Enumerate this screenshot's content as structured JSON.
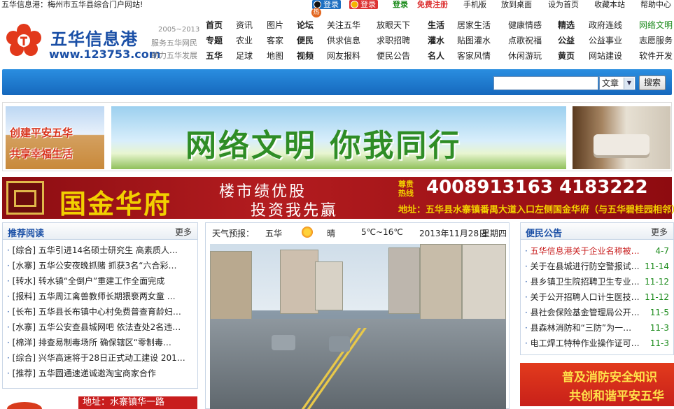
{
  "topbar": {
    "site_text": "五华信息港：梅州市五华县综合门户网站!",
    "qq_login": "登录",
    "weibo_login": "登录",
    "hot_badge": "热",
    "login": "登录",
    "register": "免费注册",
    "links": [
      "手机版",
      "放到桌面",
      "设为首页",
      "收藏本站",
      "帮助中心"
    ]
  },
  "logo": {
    "name": "五华信息港",
    "url": "www.123753.com",
    "years": "2005~2013",
    "tagline1": "服务五华网民",
    "tagline2": "助力五华发展"
  },
  "nav": {
    "rows": [
      [
        "首页",
        "资讯",
        "图片",
        "论坛",
        "关注五华",
        "放眼天下",
        "生活",
        "居家生活",
        "健康情感",
        "精选",
        "政府连线",
        "网络文明"
      ],
      [
        "专题",
        "农业",
        "客家",
        "便民",
        "供求信息",
        "求职招聘",
        "灌水",
        "贴图灌水",
        "点歌祝福",
        "公益",
        "公益事业",
        "志愿服务"
      ],
      [
        "五华",
        "足球",
        "地图",
        "视频",
        "网友报料",
        "便民公告",
        "名人",
        "客家风情",
        "休闲游玩",
        "黄页",
        "网站建设",
        "软件开发"
      ]
    ]
  },
  "search": {
    "value": "",
    "type_selected": "文章",
    "button": "搜索"
  },
  "banners": {
    "left_line1": "创建平安五华",
    "left_line2": "共享幸福生活",
    "center": "网络文明  你我同行"
  },
  "ad": {
    "brand": "国金华府",
    "slogan1": "楼市绩优股",
    "slogan2": "投资我先赢",
    "hotline_label": "尊贵热线",
    "tel": "4008913163  4183222",
    "address": "地址：五华县水寨镇番禺大道入口左侧国金华府（与五华碧桂园相邻）"
  },
  "recommend": {
    "title": "推荐阅读",
    "more": "更多",
    "items": [
      "[综合] 五华引进14名硕士研究生 高素质人…",
      "[水寨] 五华公安夜晚抓赌 抓获3名“六合彩…",
      "[转水] 转水镇“全倒户”重建工作全面完成",
      "[报料] 五华周江禽兽教师长期猥亵两女童 …",
      "[长布] 五华县长布镇中心村免费普查育龄妇…",
      "[水寨] 五华公安查县城网吧 依法查处2名违…",
      "[棉洋] 排查易制毒场所 确保辖区“零制毒…",
      "[综合] 兴华高速将于28日正式动工建设 201…",
      "[推荐] 五华圆通速递诚邀淘宝商家合作"
    ]
  },
  "weather": {
    "label": "天气预报：",
    "city": "五华",
    "condition": "晴",
    "temp": "5℃~16℃",
    "date": "2013年11月28日",
    "weekday": "星期四"
  },
  "notices": {
    "title": "便民公告",
    "more": "更多",
    "items": [
      {
        "text": "五华信息港关于企业名称被…",
        "date": "4-7",
        "highlight": true
      },
      {
        "text": "关于在县城进行防空警报试…",
        "date": "11-14",
        "highlight": false
      },
      {
        "text": "县乡镇卫生院招聘卫生专业…",
        "date": "11-12",
        "highlight": false
      },
      {
        "text": "关于公开招聘人口计生医技…",
        "date": "11-12",
        "highlight": false
      },
      {
        "text": "县社会保险基金管理局公开…",
        "date": "11-5",
        "highlight": false
      },
      {
        "text": "县森林消防和“三防”为一…",
        "date": "11-3",
        "highlight": false
      },
      {
        "text": "电工焊工特种作业操作证可…",
        "date": "11-3",
        "highlight": false
      }
    ]
  },
  "fire_banner": {
    "line1": "普及消防安全知识",
    "line2": "共创和谐平安五华"
  },
  "bottom_ad": "地址：水寨镇华一路",
  "colors": {
    "brand_blue": "#1a4fa6",
    "bar_blue": "#1668bd",
    "ad_red": "#b31c1f",
    "green": "#1a8a1a",
    "highlight_red": "#c81d1d"
  }
}
